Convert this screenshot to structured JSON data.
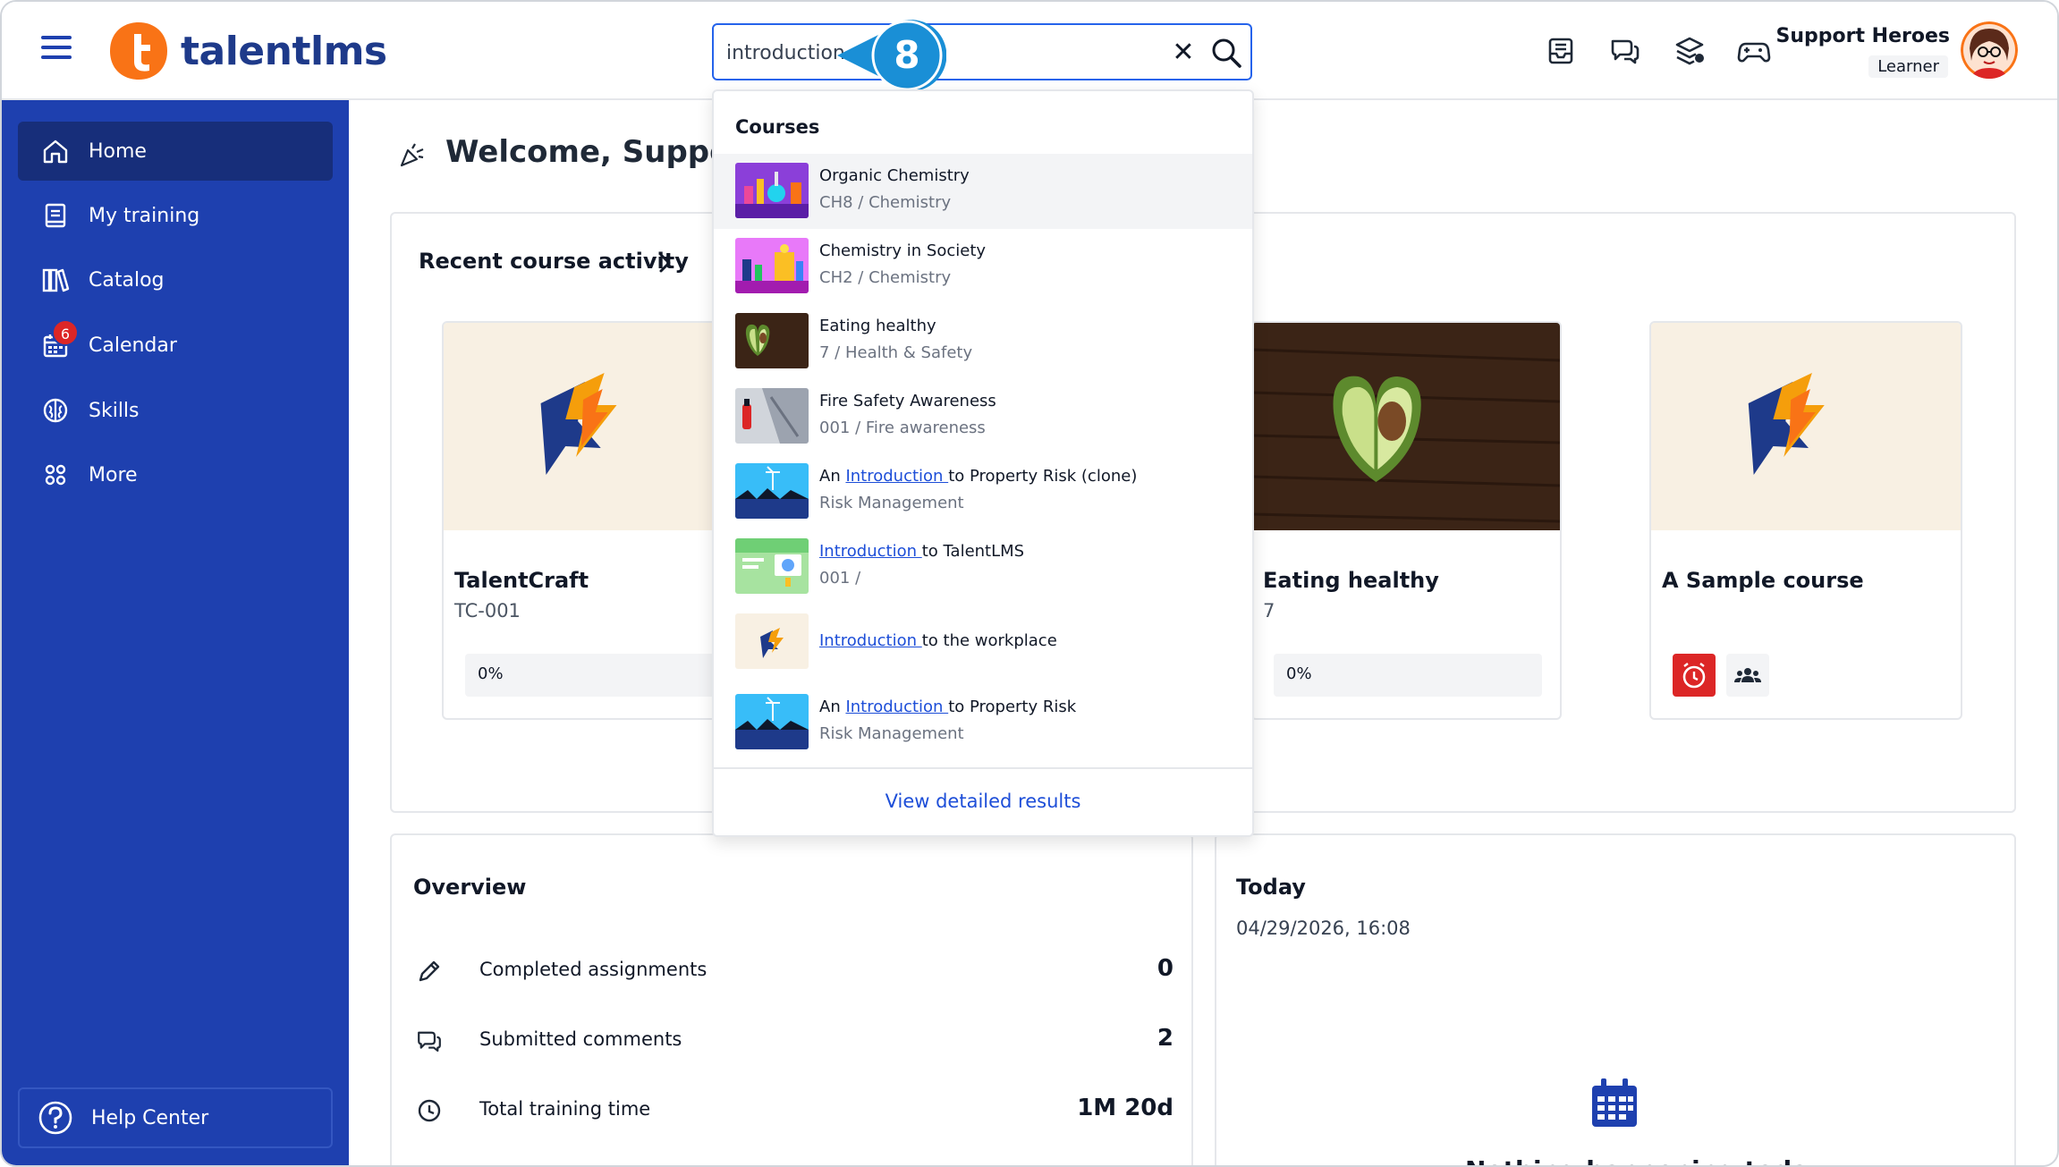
{
  "app": {
    "brand": "talentlms",
    "brand_color": "#f97316",
    "accent_color": "#1e40af"
  },
  "search": {
    "value": "introduction",
    "placeholder": "",
    "clear_icon": "close-icon",
    "submit_icon": "search-icon"
  },
  "callout": {
    "number": "8",
    "color": "#1a8fd6"
  },
  "header_icons": [
    "inbox-icon",
    "messages-icon",
    "layers-icon",
    "gamepad-icon"
  ],
  "user": {
    "name": "Support Heroes",
    "role": "Learner"
  },
  "sidebar": {
    "items": [
      {
        "label": "Home",
        "icon": "home-icon",
        "active": true
      },
      {
        "label": "My training",
        "icon": "notebook-icon"
      },
      {
        "label": "Catalog",
        "icon": "library-icon"
      },
      {
        "label": "Calendar",
        "icon": "calendar-icon",
        "badge": "6"
      },
      {
        "label": "Skills",
        "icon": "brain-icon"
      },
      {
        "label": "More",
        "icon": "grid-icon"
      }
    ],
    "help": "Help Center"
  },
  "welcome": "Welcome, Support",
  "recent": {
    "title": "Recent course activity",
    "cards": [
      {
        "title": "TalentCraft",
        "code": "TC-001",
        "progress": "0%"
      },
      {
        "title": "Eating healthy",
        "code": "7",
        "progress": "0%"
      },
      {
        "title": "A Sample course",
        "code": ""
      }
    ]
  },
  "dropdown": {
    "heading": "Courses",
    "results": [
      {
        "title": "Organic Chemistry",
        "sub": "CH8 / Chemistry"
      },
      {
        "title": "Chemistry in Society",
        "sub": "CH2 / Chemistry"
      },
      {
        "title": "Eating healthy",
        "sub": "7 / Health & Safety"
      },
      {
        "title": "Fire Safety Awareness",
        "sub": "001 / Fire awareness"
      },
      {
        "pre": "An ",
        "hl": "Introduction ",
        "post": "to Property Risk (clone)",
        "sub": "Risk Management"
      },
      {
        "pre": "",
        "hl": "Introduction ",
        "post": "to TalentLMS",
        "sub": "001 /"
      },
      {
        "pre": "",
        "hl": "Introduction ",
        "post": "to the workplace",
        "sub": ""
      },
      {
        "pre": "An ",
        "hl": "Introduction ",
        "post": "to Property Risk",
        "sub": "Risk Management"
      }
    ],
    "view_all": "View detailed results"
  },
  "overview": {
    "title": "Overview",
    "rows": [
      {
        "label": "Completed assignments",
        "value": "0"
      },
      {
        "label": "Submitted comments",
        "value": "2"
      },
      {
        "label": "Total training time",
        "value": "1M 20d"
      }
    ]
  },
  "today": {
    "title": "Today",
    "datetime": "04/29/2026, 16:08",
    "empty": "Nothing happening today"
  }
}
